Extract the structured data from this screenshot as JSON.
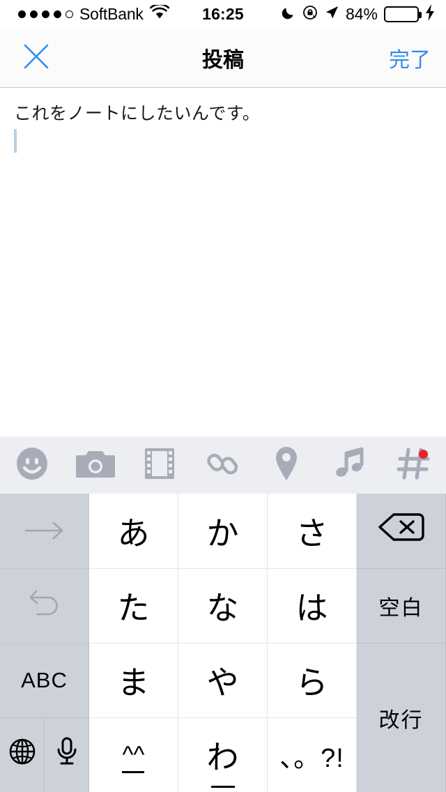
{
  "status_bar": {
    "signal_dots_total": 5,
    "signal_dots_filled": 4,
    "carrier": "SoftBank",
    "wifi_icon": "wifi-icon",
    "time": "16:25",
    "do_not_disturb_icon": "moon-icon",
    "rotation_lock_icon": "rotation-lock-icon",
    "location_icon": "location-arrow-icon",
    "battery_percent": "84%",
    "battery_level": 84,
    "charging_icon": "lightning-bolt-icon",
    "battery_color": "#4CD964"
  },
  "nav_bar": {
    "close_icon": "close-x-icon",
    "title": "投稿",
    "done_label": "完了",
    "accent_color": "#2f8bef"
  },
  "composer": {
    "text": "これをノートにしたいんです。",
    "caret_visible": true
  },
  "toolbar": {
    "items": [
      {
        "name": "emoji-icon",
        "label": "顔文字"
      },
      {
        "name": "camera-icon",
        "label": "カメラ"
      },
      {
        "name": "film-icon",
        "label": "動画"
      },
      {
        "name": "link-icon",
        "label": "リンク"
      },
      {
        "name": "location-pin-icon",
        "label": "位置情報"
      },
      {
        "name": "music-note-icon",
        "label": "音楽"
      },
      {
        "name": "hashtag-icon",
        "label": "ハッシュタグ",
        "badge": true
      }
    ],
    "icon_color": "#a7acb8",
    "badge_color": "#e8232a",
    "background": "#eceef1"
  },
  "keyboard": {
    "type": "japanese-kana-10key",
    "background": "#cdd1da",
    "rows": [
      [
        {
          "name": "next-candidate-key",
          "label": "→",
          "style": "gray",
          "dim": true
        },
        {
          "name": "key-a",
          "label": "あ",
          "style": "white"
        },
        {
          "name": "key-ka",
          "label": "か",
          "style": "white"
        },
        {
          "name": "key-sa",
          "label": "さ",
          "style": "white"
        },
        {
          "name": "backspace-key",
          "label": "⌫",
          "style": "gray"
        }
      ],
      [
        {
          "name": "undo-key",
          "label": "↺",
          "style": "gray",
          "dim": true
        },
        {
          "name": "key-ta",
          "label": "た",
          "style": "white"
        },
        {
          "name": "key-na",
          "label": "な",
          "style": "white"
        },
        {
          "name": "key-ha",
          "label": "は",
          "style": "white"
        },
        {
          "name": "space-key",
          "label": "空白",
          "style": "gray"
        }
      ],
      [
        {
          "name": "abc-mode-key",
          "label": "ABC",
          "style": "gray"
        },
        {
          "name": "key-ma",
          "label": "ま",
          "style": "white"
        },
        {
          "name": "key-ya",
          "label": "や",
          "style": "white"
        },
        {
          "name": "key-ra",
          "label": "ら",
          "style": "white"
        },
        {
          "name": "return-key",
          "label": "改行",
          "style": "gray"
        }
      ],
      [
        {
          "name": "globe-key",
          "label": "🌐",
          "style": "gray"
        },
        {
          "name": "dictation-key",
          "label": "🎤",
          "style": "gray"
        },
        {
          "name": "key-kaomoji",
          "label": "^_^",
          "style": "white"
        },
        {
          "name": "key-wa",
          "label": "わ",
          "style": "white"
        },
        {
          "name": "key-punctuation",
          "label": "、。?!",
          "style": "white"
        }
      ]
    ]
  }
}
